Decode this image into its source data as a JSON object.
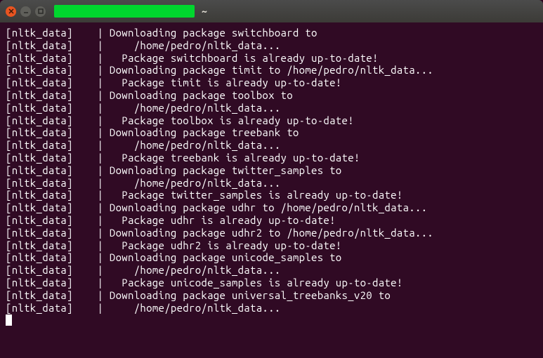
{
  "window": {
    "title_suffix": "~"
  },
  "terminal": {
    "lines": [
      "[nltk_data]    | Downloading package switchboard to",
      "[nltk_data]    |     /home/pedro/nltk_data...",
      "[nltk_data]    |   Package switchboard is already up-to-date!",
      "[nltk_data]    | Downloading package timit to /home/pedro/nltk_data...",
      "[nltk_data]    |   Package timit is already up-to-date!",
      "[nltk_data]    | Downloading package toolbox to",
      "[nltk_data]    |     /home/pedro/nltk_data...",
      "[nltk_data]    |   Package toolbox is already up-to-date!",
      "[nltk_data]    | Downloading package treebank to",
      "[nltk_data]    |     /home/pedro/nltk_data...",
      "[nltk_data]    |   Package treebank is already up-to-date!",
      "[nltk_data]    | Downloading package twitter_samples to",
      "[nltk_data]    |     /home/pedro/nltk_data...",
      "[nltk_data]    |   Package twitter_samples is already up-to-date!",
      "[nltk_data]    | Downloading package udhr to /home/pedro/nltk_data...",
      "[nltk_data]    |   Package udhr is already up-to-date!",
      "[nltk_data]    | Downloading package udhr2 to /home/pedro/nltk_data...",
      "[nltk_data]    |   Package udhr2 is already up-to-date!",
      "[nltk_data]    | Downloading package unicode_samples to",
      "[nltk_data]    |     /home/pedro/nltk_data...",
      "[nltk_data]    |   Package unicode_samples is already up-to-date!",
      "[nltk_data]    | Downloading package universal_treebanks_v20 to",
      "[nltk_data]    |     /home/pedro/nltk_data..."
    ]
  }
}
